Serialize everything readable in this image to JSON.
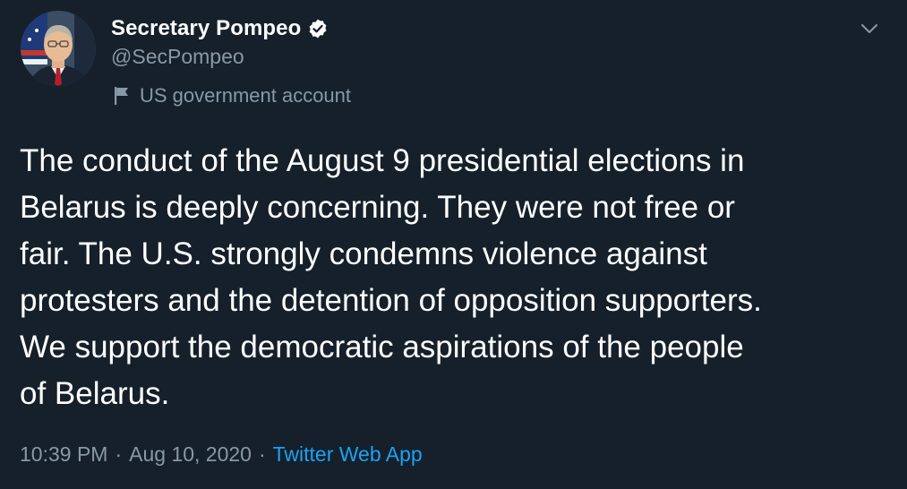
{
  "author": {
    "display_name": "Secretary Pompeo",
    "handle": "@SecPompeo",
    "label": "US government account",
    "avatar_icon": "profile-photo",
    "verified_icon": "verified-badge-icon"
  },
  "tweet": {
    "text": "The conduct of the August 9 presidential elections in\nBelarus is deeply concerning. They were not free or\nfair. The U.S. strongly condemns violence against\nprotesters and the detention of opposition supporters.\nWe support the democratic aspirations of the people\nof Belarus.",
    "time": "10:39 PM",
    "separator": "·",
    "date": "Aug 10, 2020",
    "source": "Twitter Web App"
  },
  "colors": {
    "background": "#15202b",
    "text": "#ffffff",
    "secondary": "#8899a6",
    "link": "#1da1f2"
  }
}
